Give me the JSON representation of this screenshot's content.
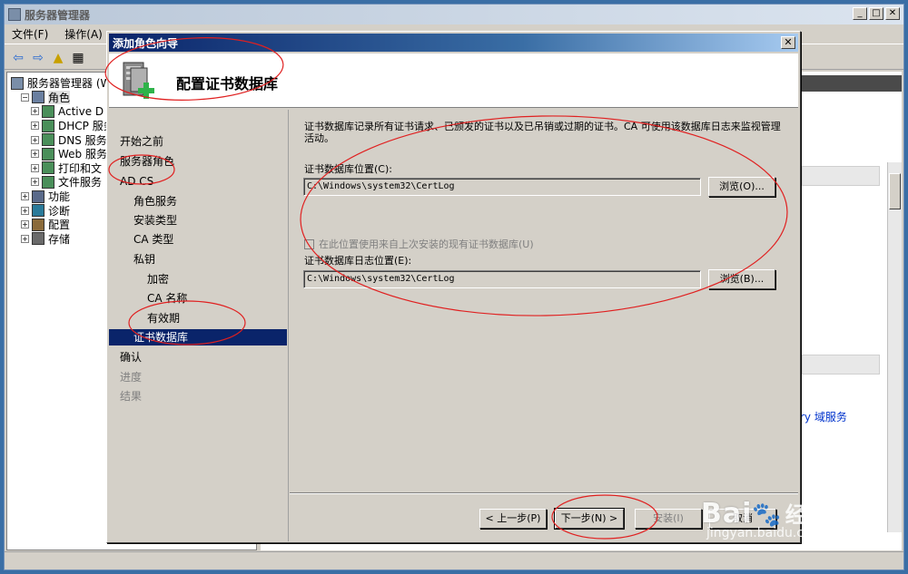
{
  "main_window": {
    "title": "服务器管理器",
    "menu": [
      "文件(F)",
      "操作(A)"
    ]
  },
  "tree": {
    "items": [
      {
        "label": "服务器管理器 (W",
        "level": 0,
        "toggle": "",
        "icon": "server-manager-icon"
      },
      {
        "label": "角色",
        "level": 1,
        "toggle": "−",
        "icon": "roles-icon",
        "selected": true
      },
      {
        "label": "Active D",
        "level": 2,
        "toggle": "+",
        "icon": "role-icon"
      },
      {
        "label": "DHCP 服务",
        "level": 2,
        "toggle": "+",
        "icon": "role-icon"
      },
      {
        "label": "DNS 服务",
        "level": 2,
        "toggle": "+",
        "icon": "role-icon"
      },
      {
        "label": "Web 服务",
        "level": 2,
        "toggle": "+",
        "icon": "role-icon"
      },
      {
        "label": "打印和文",
        "level": 2,
        "toggle": "+",
        "icon": "role-icon"
      },
      {
        "label": "文件服务",
        "level": 2,
        "toggle": "+",
        "icon": "role-icon"
      },
      {
        "label": "功能",
        "level": 1,
        "toggle": "+",
        "icon": "features-icon"
      },
      {
        "label": "诊断",
        "level": 1,
        "toggle": "+",
        "icon": "diagnostics-icon"
      },
      {
        "label": "配置",
        "level": 1,
        "toggle": "+",
        "icon": "configuration-icon"
      },
      {
        "label": "存储",
        "level": 1,
        "toggle": "+",
        "icon": "storage-icon"
      }
    ]
  },
  "right_pane": {
    "link_text": "ry 域服务"
  },
  "wizard": {
    "title": "添加角色向导",
    "header_title": "配置证书数据库",
    "nav": [
      {
        "label": "开始之前",
        "level": 0,
        "state": "normal"
      },
      {
        "label": "服务器角色",
        "level": 0,
        "state": "normal"
      },
      {
        "label": "AD CS",
        "level": 0,
        "state": "normal"
      },
      {
        "label": "角色服务",
        "level": 1,
        "state": "normal"
      },
      {
        "label": "安装类型",
        "level": 1,
        "state": "normal"
      },
      {
        "label": "CA 类型",
        "level": 1,
        "state": "normal"
      },
      {
        "label": "私钥",
        "level": 1,
        "state": "normal"
      },
      {
        "label": "加密",
        "level": 2,
        "state": "normal"
      },
      {
        "label": "CA 名称",
        "level": 2,
        "state": "normal"
      },
      {
        "label": "有效期",
        "level": 2,
        "state": "normal"
      },
      {
        "label": "证书数据库",
        "level": 1,
        "state": "active"
      },
      {
        "label": "确认",
        "level": 0,
        "state": "normal"
      },
      {
        "label": "进度",
        "level": 0,
        "state": "disabled"
      },
      {
        "label": "结果",
        "level": 0,
        "state": "disabled"
      }
    ],
    "description": "证书数据库记录所有证书请求、已颁发的证书以及已吊销或过期的证书。CA 可使用该数据库日志来监视管理活动。",
    "db_location_label": "证书数据库位置(C):",
    "db_location_value": "C:\\Windows\\system32\\CertLog",
    "browse_db_label": "浏览(O)...",
    "reuse_checkbox_label": "在此位置使用来自上次安装的现有证书数据库(U)",
    "log_location_label": "证书数据库日志位置(E):",
    "log_location_value": "C:\\Windows\\system32\\CertLog",
    "browse_log_label": "浏览(B)...",
    "back_label": "< 上一步(P)",
    "next_label": "下一步(N) >",
    "install_label": "安装(I)",
    "cancel_label": "取消"
  },
  "watermark": {
    "brand": "Bai",
    "brand_cn": "经验",
    "url": "jingyan.baidu.com"
  },
  "colors": {
    "desktop": "#3a6ea5",
    "titlebar_active": "#0a246a",
    "selection": "#0a246a",
    "annotation_red": "#e02020"
  }
}
